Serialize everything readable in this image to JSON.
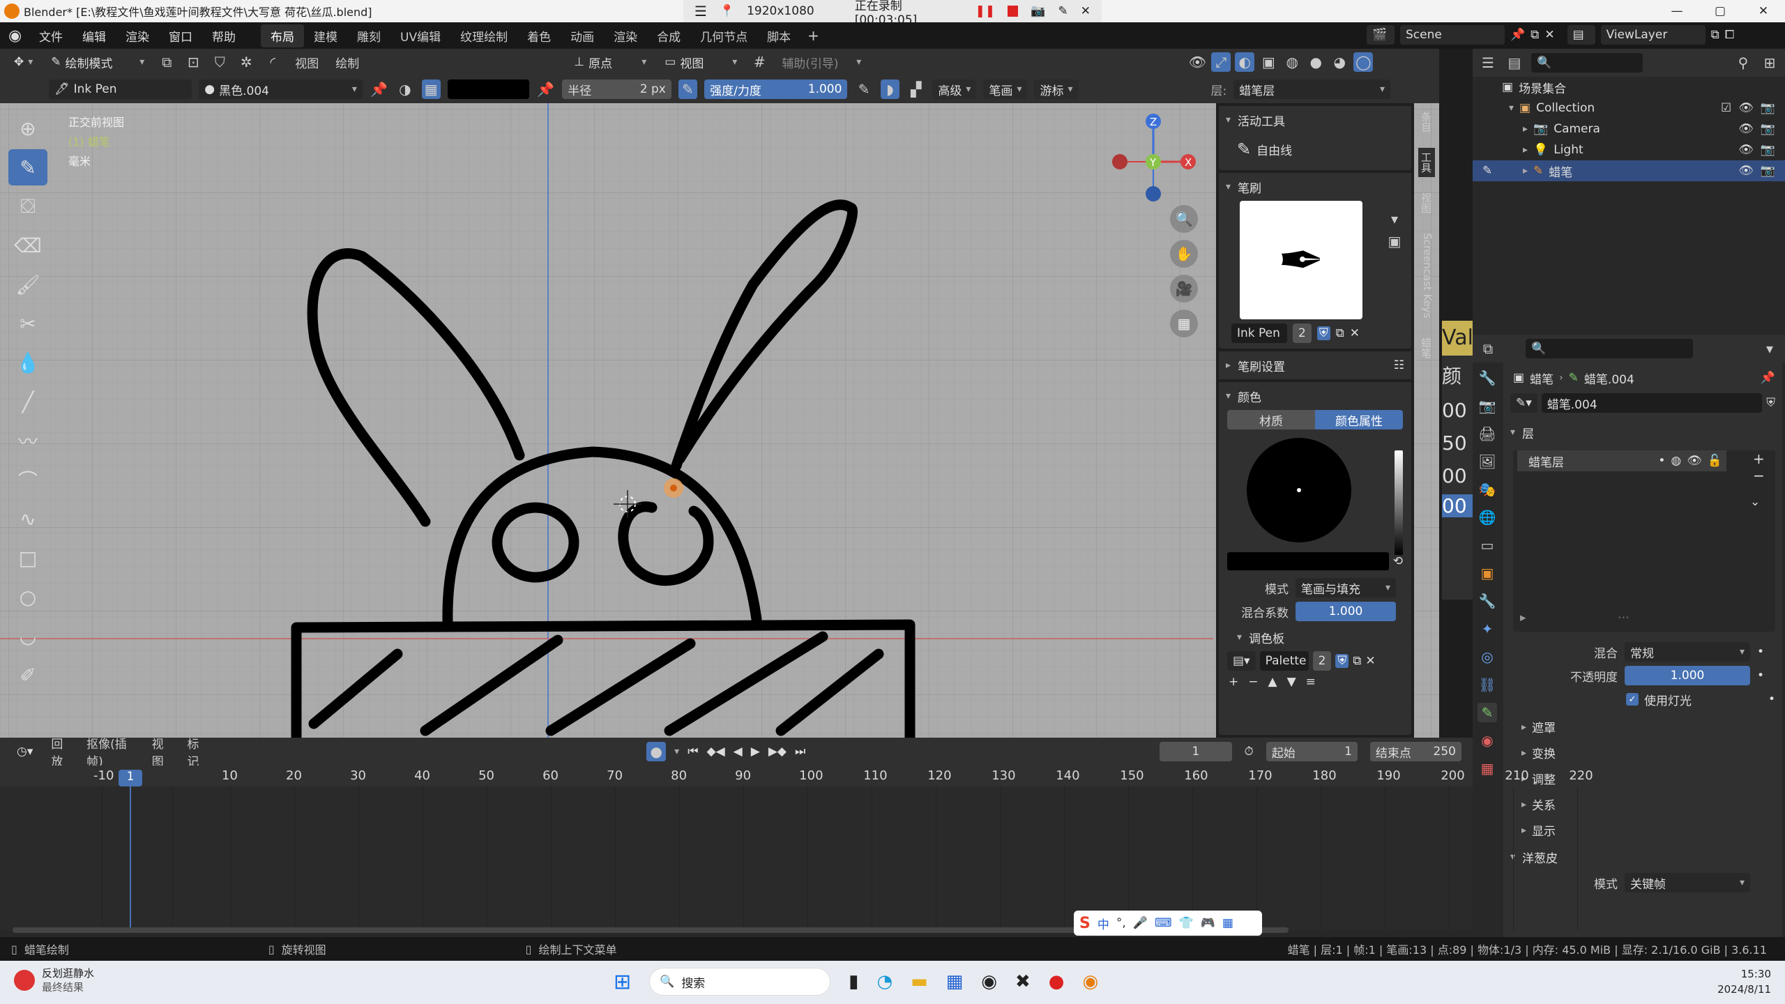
{
  "titlebar": {
    "title": "Blender* [E:\\教程文件\\鱼戏莲叶间教程文件\\大写意 荷花\\丝瓜.blend]",
    "record_res": "1920x1080",
    "record_status": "正在录制 [00:03:05]"
  },
  "menu": {
    "items": [
      "文件",
      "编辑",
      "渲染",
      "窗口",
      "帮助"
    ],
    "workspaces": [
      "布局",
      "建模",
      "雕刻",
      "UV编辑",
      "纹理绘制",
      "着色",
      "动画",
      "渲染",
      "合成",
      "几何节点",
      "脚本"
    ],
    "scene": "Scene",
    "viewlayer": "ViewLayer"
  },
  "toolbar": {
    "mode": "绘制模式",
    "view": "视图",
    "draw": "绘制",
    "origin": "原点",
    "view2": "视图",
    "guides": "辅助(引导)"
  },
  "toolsettings": {
    "brush": "Ink Pen",
    "material": "黑色.004",
    "radius_label": "半径",
    "radius_value": "2 px",
    "strength_label": "强度/力度",
    "strength_value": "1.000",
    "advanced": "高级",
    "stroke": "笔画",
    "cursor": "游标",
    "layer_label": "层:",
    "layer_value": "蜡笔层"
  },
  "viewport": {
    "view_name": "正交前视图",
    "object_name": "(1) 蜡笔",
    "units": "毫米"
  },
  "npanel": {
    "active_tool_hdr": "活动工具",
    "active_tool": "自由线",
    "brush_hdr": "笔刷",
    "brush_name": "Ink Pen",
    "brush_users": "2",
    "brush_settings_hdr": "笔刷设置",
    "color_hdr": "颜色",
    "tab_material": "材质",
    "tab_color": "颜色属性",
    "mode_label": "模式",
    "mode_value": "笔画与填充",
    "mix_label": "混合系数",
    "mix_value": "1.000",
    "palette_hdr": "调色板",
    "palette_name": "Palette",
    "palette_users": "2",
    "side_tabs": [
      "条目",
      "工具",
      "视图",
      "Screencast Keys",
      "蜡笔"
    ]
  },
  "partial_panel": {
    "texts": [
      "Valu",
      "颜",
      "00",
      "50",
      "00",
      "00"
    ]
  },
  "outliner": {
    "root": "场景集合",
    "items": [
      {
        "name": "Collection",
        "depth": 0,
        "icon": "collection-icon"
      },
      {
        "name": "Camera",
        "depth": 1,
        "icon": "camera-icon"
      },
      {
        "name": "Light",
        "depth": 1,
        "icon": "light-icon"
      },
      {
        "name": "蜡笔",
        "depth": 1,
        "icon": "gpencil-icon"
      }
    ]
  },
  "properties": {
    "breadcrumb_obj": "蜡笔",
    "breadcrumb_data": "蜡笔.004",
    "data_name": "蜡笔.004",
    "layers_hdr": "层",
    "layer_item": "蜡笔层",
    "blend_label": "混合",
    "blend_value": "常规",
    "opacity_label": "不透明度",
    "opacity_value": "1.000",
    "use_lights": "使用灯光",
    "subpanels": [
      "遮罩",
      "变换",
      "调整",
      "关系",
      "显示"
    ],
    "onion_hdr": "洋葱皮",
    "onion_mode_label": "模式",
    "onion_mode_value": "关键帧"
  },
  "timeline": {
    "menus": [
      "回放",
      "抠像(插帧)",
      "视图",
      "标记"
    ],
    "current_frame": "1",
    "start_label": "起始",
    "start_value": "1",
    "end_label": "结束点",
    "end_value": "250",
    "ticks": [
      "-10",
      "1",
      "10",
      "20",
      "30",
      "40",
      "50",
      "60",
      "70",
      "80",
      "90",
      "100",
      "110",
      "120",
      "130",
      "140",
      "150",
      "160",
      "170",
      "180",
      "190",
      "200",
      "210",
      "220"
    ],
    "playhead": "1"
  },
  "statusbar": {
    "left1": "蜡笔绘制",
    "left2": "旋转视图",
    "left3": "绘制上下文菜单",
    "stats": "蜡笔 | 层:1 | 帧:1 | 笔画:13 | 点:89 | 物体:1/3 | 内存: 45.0 MiB | 显存: 2.1/16.0 GiB | 3.6.11"
  },
  "ime": {
    "text": "中"
  },
  "taskbar": {
    "weather_title": "反划逛静水",
    "weather_sub": "最终结果",
    "search": "搜索",
    "time": "15:30",
    "date": "2024/8/11"
  }
}
